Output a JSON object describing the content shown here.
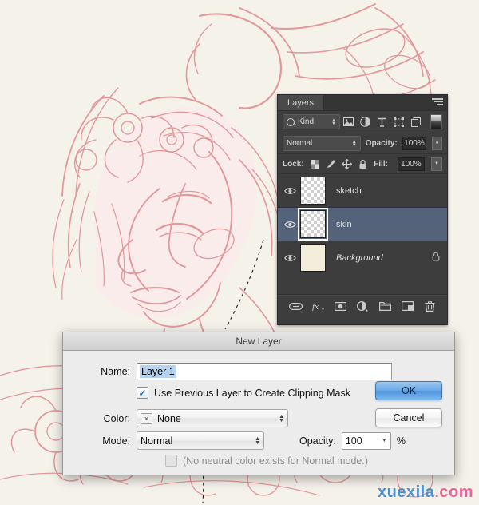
{
  "artwork": {
    "description": "pencil sketch of a girl in profile with flower crown",
    "line_color": "#e08a8f",
    "fill_color": "#fbe9e6",
    "background_color": "#f5f2ea"
  },
  "layers_panel": {
    "tab_label": "Layers",
    "menu_icon": "panel-menu-icon",
    "filter": {
      "kind_label": "Kind",
      "search_icon": "search-icon",
      "icons": [
        "pixel-layer-filter-icon",
        "adjustment-layer-filter-icon",
        "type-layer-filter-icon",
        "shape-layer-filter-icon",
        "smart-object-filter-icon"
      ],
      "toggle_icon": "filter-toggle-icon"
    },
    "blend": {
      "mode_value": "Normal",
      "opacity_label": "Opacity:",
      "opacity_value": "100%"
    },
    "lock": {
      "label": "Lock:",
      "icons": [
        "lock-transparent-pixels-icon",
        "lock-image-pixels-icon",
        "lock-position-icon",
        "lock-all-icon"
      ],
      "fill_label": "Fill:",
      "fill_value": "100%"
    },
    "layers": [
      {
        "name": "sketch",
        "visible": true,
        "selected": false,
        "locked": false,
        "thumb": "transparent",
        "italic": false
      },
      {
        "name": "skin",
        "visible": true,
        "selected": true,
        "locked": false,
        "thumb": "transparent",
        "italic": false
      },
      {
        "name": "Background",
        "visible": true,
        "selected": false,
        "locked": true,
        "thumb": "solid",
        "italic": true
      }
    ],
    "bottom_icons": [
      "link-layers-icon",
      "layer-style-fx-icon",
      "add-layer-mask-icon",
      "new-adjustment-layer-icon",
      "new-group-icon",
      "new-layer-icon",
      "delete-layer-icon"
    ]
  },
  "dialog": {
    "title": "New Layer",
    "name_label": "Name:",
    "name_value": "Layer 1",
    "clipping_checkbox_label": "Use Previous Layer to Create Clipping Mask",
    "clipping_checked": true,
    "color_label": "Color:",
    "color_value": "None",
    "color_badge": "×",
    "mode_label": "Mode:",
    "mode_value": "Normal",
    "opacity_label": "Opacity:",
    "opacity_value": "100",
    "percent_symbol": "%",
    "neutral_note": "(No neutral color exists for Normal mode.)",
    "neutral_checked": false,
    "ok_label": "OK",
    "cancel_label": "Cancel"
  },
  "watermark": {
    "part_a": "xuexila",
    "part_b": ".com"
  }
}
